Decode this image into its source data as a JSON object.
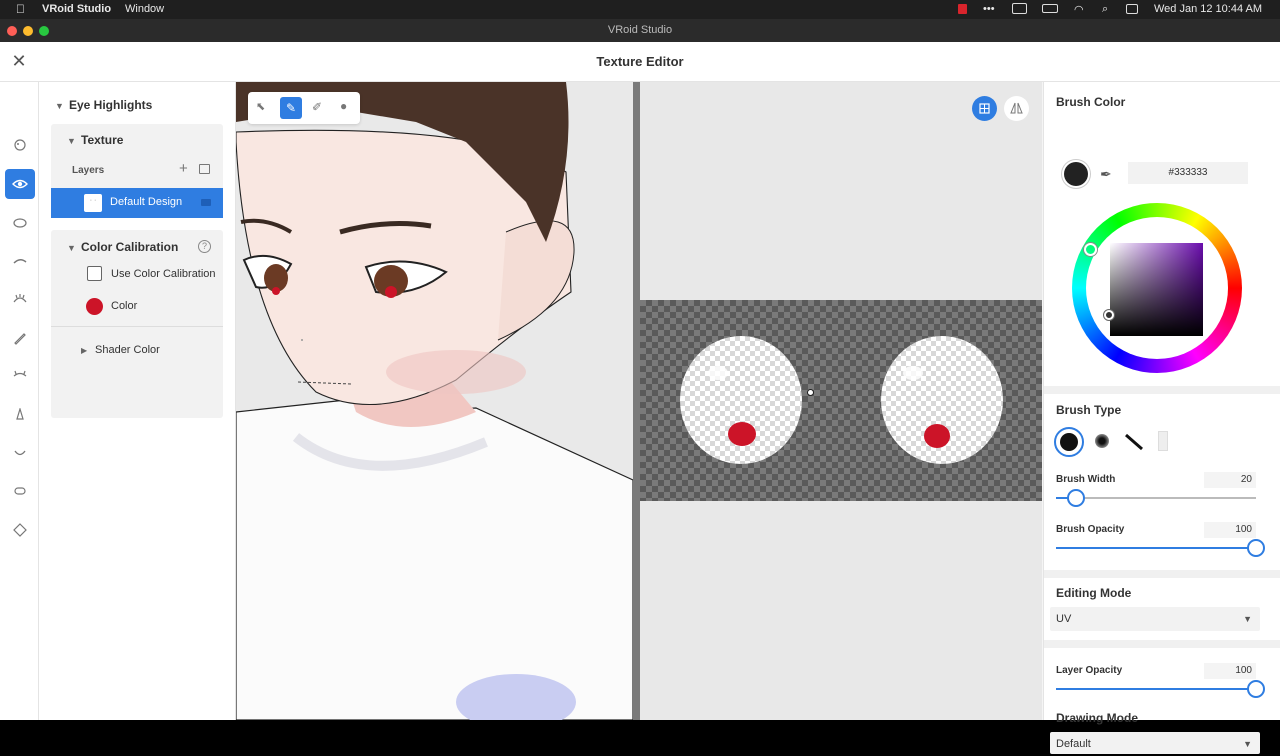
{
  "menubar": {
    "app_name": "VRoid Studio",
    "window_menu": "Window",
    "datetime": "Wed Jan 12  10:44 AM"
  },
  "window": {
    "title": "VRoid Studio"
  },
  "editor": {
    "title": "Texture Editor",
    "close_glyph": "✕"
  },
  "rail": {
    "icons": [
      "face-icon",
      "eye-icon",
      "iris-icon",
      "eyebrow-icon",
      "eyelash-icon",
      "eyeliner-icon",
      "eyelid-icon",
      "nose-icon",
      "mouth-icon",
      "ear-icon",
      "face-shape-icon"
    ],
    "active_index": 1
  },
  "layer_panel": {
    "group_title": "Eye Highlights",
    "texture_title": "Texture",
    "layers_label": "Layers",
    "layer_name": "Default Design",
    "color_calibration_title": "Color Calibration",
    "use_color_calibration_label": "Use Color Calibration",
    "color_label": "Color",
    "color_swatch": "#cc1428",
    "shader_color_label": "Shader Color"
  },
  "tools": [
    "select-icon",
    "pen-icon",
    "eraser-icon",
    "fill-icon"
  ],
  "active_tool": "pen-icon",
  "right_panel": {
    "brush_color_title": "Brush Color",
    "brush_color_hex": "#333333",
    "brush_type_title": "Brush Type",
    "brush_width_label": "Brush Width",
    "brush_width_value": "20",
    "brush_width_fraction": 0.1,
    "brush_opacity_label": "Brush Opacity",
    "brush_opacity_value": "100",
    "brush_opacity_fraction": 1.0,
    "editing_mode_title": "Editing Mode",
    "editing_mode_value": "UV",
    "layer_opacity_label": "Layer Opacity",
    "layer_opacity_value": "100",
    "layer_opacity_fraction": 1.0,
    "drawing_mode_title": "Drawing Mode",
    "drawing_mode_value": "Default"
  },
  "colors": {
    "accent": "#2f7de1",
    "highlight_red": "#cc1428"
  }
}
